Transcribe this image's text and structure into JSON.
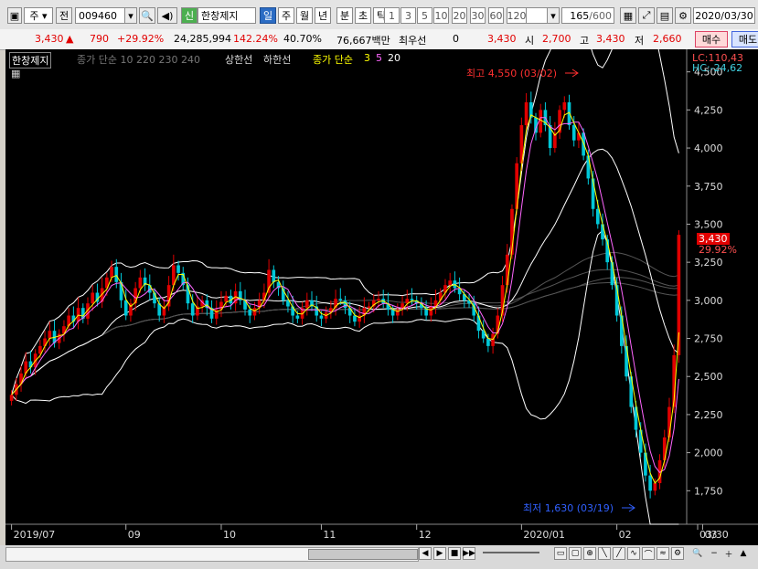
{
  "toolbar": {
    "market": "주",
    "prev": "전",
    "code": "009460",
    "credit_badge": "신",
    "stock_name": "한창제지",
    "periods": [
      "일",
      "주",
      "월",
      "년",
      "분",
      "초",
      "틱"
    ],
    "active_period": "일",
    "intervals": [
      "1",
      "3",
      "5",
      "10",
      "20",
      "30",
      "60",
      "120"
    ],
    "count": "165",
    "count_max": "/600",
    "date": "2020/03/30"
  },
  "quote": {
    "price": "3,430",
    "change": "790",
    "change_rate": "+29.92%",
    "volume": "24,285,994",
    "volume_ratio": "142.24%",
    "turnover": "40.70%",
    "amount": "76,667백만",
    "priority_label": "최우선",
    "priority_value": "0",
    "price2": "3,430",
    "open_label": "시",
    "open": "2,700",
    "high_label": "고",
    "high": "3,430",
    "low_label": "저",
    "low": "2,660",
    "buy_label": "매수",
    "sell_label": "매도"
  },
  "legend": {
    "name": "한창제지",
    "ma_label": "종가 단순 10 220 230 240",
    "upper": "상한선",
    "lower": "하한선",
    "ma2_label": "종가 단순",
    "ma2": [
      "3",
      "5",
      "20"
    ]
  },
  "annotations": {
    "lc": "LC:110,43",
    "hc": "HC:-24,62",
    "high_note": "최고 4,550 (03/02)",
    "low_note": "최저 1,630 (03/19)",
    "last_price": "3,430",
    "last_rate": "29.92%"
  },
  "colors": {
    "up": "#e10000",
    "down": "#00c8d8",
    "bb": "#ffffff",
    "ma3": "#ffff00",
    "ma5": "#ff66ff",
    "ma20": "#ffffff"
  },
  "chart_data": {
    "type": "candlestick",
    "x_ticks": [
      "2019/07",
      "09",
      "10",
      "11",
      "12",
      "2020/01",
      "02",
      "03",
      "03/30"
    ],
    "y_ticks": [
      1750,
      2000,
      2250,
      2500,
      2750,
      3000,
      3250,
      3500,
      3750,
      4000,
      4250,
      4500
    ],
    "ylim": [
      1530,
      4600
    ],
    "points": 165,
    "close": [
      2380,
      2450,
      2520,
      2600,
      2560,
      2650,
      2700,
      2750,
      2800,
      2720,
      2780,
      2830,
      2900,
      2860,
      2950,
      2880,
      2980,
      3050,
      2990,
      3080,
      3150,
      3220,
      3120,
      3000,
      2900,
      2980,
      3080,
      3150,
      3100,
      3050,
      2980,
      2900,
      2960,
      3100,
      3230,
      3180,
      3100,
      2980,
      2900,
      2960,
      3000,
      2950,
      2880,
      2940,
      2990,
      3030,
      2980,
      3060,
      3000,
      2940,
      2900,
      2950,
      3000,
      3050,
      3200,
      3120,
      3080,
      3000,
      2960,
      2900,
      2880,
      2950,
      3000,
      2960,
      2900,
      2880,
      2920,
      2950,
      3010,
      3000,
      2950,
      2900,
      2860,
      2900,
      2950,
      2960,
      3000,
      3010,
      2980,
      2940,
      2900,
      2940,
      2980,
      3010,
      3000,
      2980,
      2950,
      2900,
      2960,
      3000,
      3050,
      3100,
      3130,
      3080,
      3040,
      3000,
      2980,
      2900,
      2800,
      2750,
      2700,
      2780,
      2900,
      3100,
      3300,
      3600,
      3900,
      4150,
      4300,
      4200,
      4100,
      4250,
      4150,
      4000,
      4100,
      4250,
      4300,
      4150,
      4050,
      4100,
      3950,
      3800,
      3600,
      3500,
      3400,
      3250,
      3100,
      2900,
      2700,
      2500,
      2300,
      2150,
      2000,
      1850,
      1750,
      1800,
      1950,
      2100,
      2300,
      2640,
      3430
    ],
    "series": [
      {
        "name": "상한선"
      },
      {
        "name": "하한선"
      }
    ]
  },
  "bottom": {
    "buttons": [
      "◀",
      "▶",
      "■",
      "▶▶"
    ]
  }
}
